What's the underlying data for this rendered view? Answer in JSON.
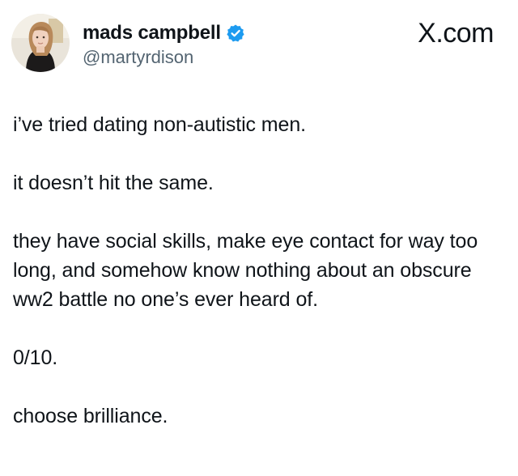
{
  "author": {
    "display_name": "mads campbell",
    "handle": "@martyrdison",
    "verified": true,
    "verified_icon": "verified-badge-icon",
    "verified_color": "#1d9bf0"
  },
  "watermark": "X.com",
  "tweet": {
    "paragraphs": [
      "i’ve tried dating non-autistic men.",
      "it doesn’t hit the same.",
      "they have social skills, make eye contact for way too long, and somehow know nothing about an obscure ww2 battle no one’s ever heard of.",
      "0/10.",
      "choose brilliance."
    ]
  }
}
